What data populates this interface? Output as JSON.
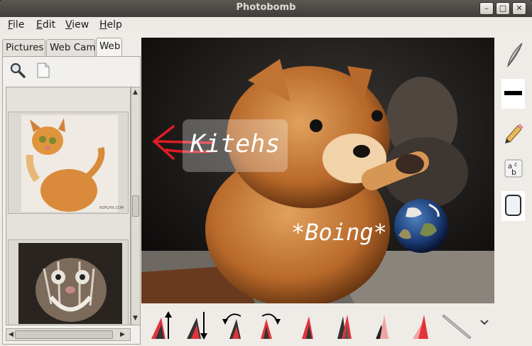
{
  "window": {
    "title": "Photobomb"
  },
  "menu": [
    {
      "label": "File",
      "accel": "F",
      "rest": "ile"
    },
    {
      "label": "Edit",
      "accel": "E",
      "rest": "dit"
    },
    {
      "label": "View",
      "accel": "V",
      "rest": "iew"
    },
    {
      "label": "Help",
      "accel": "H",
      "rest": "elp"
    }
  ],
  "tabs": [
    "Pictures",
    "Web Cam",
    "Web"
  ],
  "active_tab": "Web",
  "canvas": {
    "labels": [
      "Kitehs",
      "*Boing*"
    ],
    "watermark": "ROFLPIX.COM"
  },
  "bottom_tools": [
    "move-up-icon",
    "move-down-icon",
    "rotate-left-icon",
    "rotate-right-icon",
    "flip-layer-icon",
    "stack-layer-icon",
    "shear-layer-icon",
    "skew-layer-icon",
    "line-tool-icon",
    "more-arrow-icon"
  ],
  "right_tools": [
    "feather-icon",
    "line-width-icon",
    "pencil-icon",
    "text-tool-icon",
    "color-swatch-icon"
  ]
}
